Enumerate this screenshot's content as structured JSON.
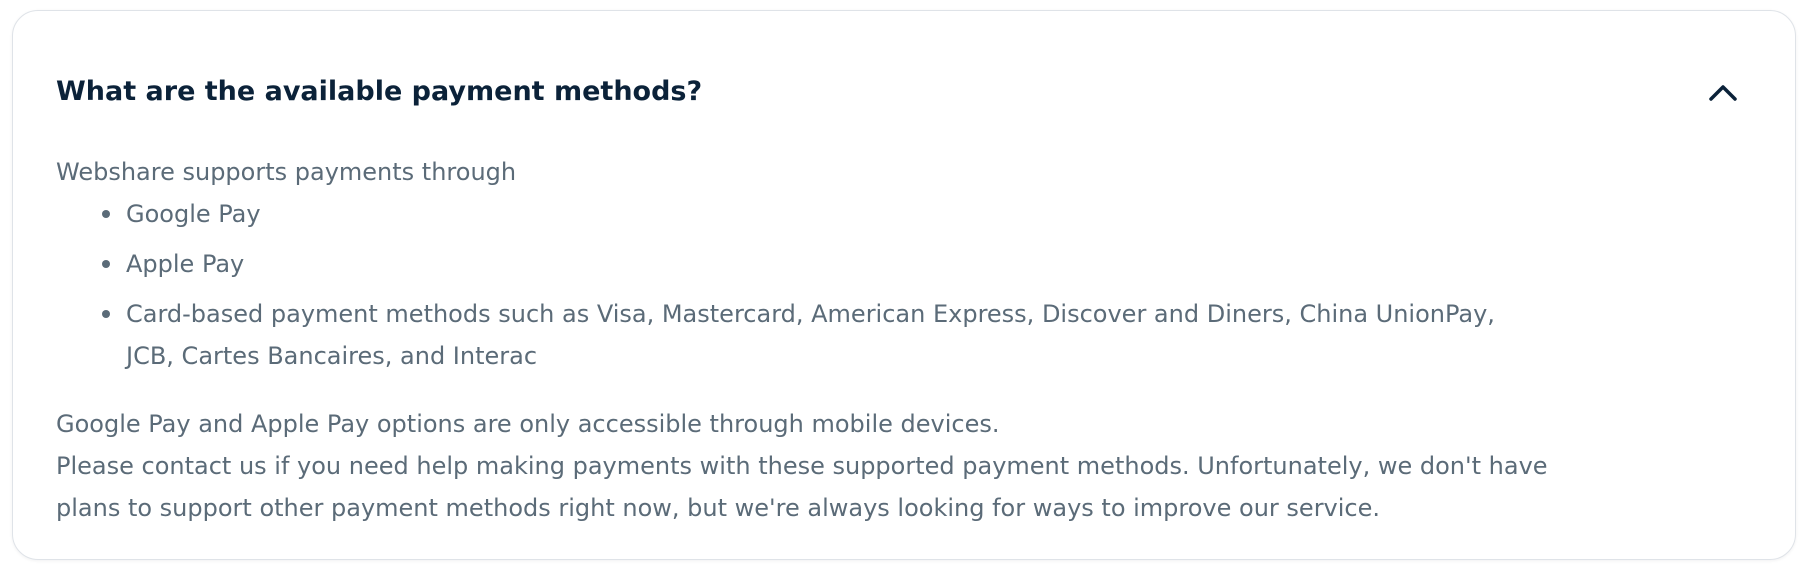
{
  "faq": {
    "question": "What are the available payment methods?",
    "toggle_icon": "chevron-up-icon",
    "answer": {
      "intro": "Webshare supports payments through",
      "methods": [
        {
          "label": "Google Pay"
        },
        {
          "label": "Apple Pay"
        },
        {
          "label": "Card-based payment methods such as Visa, Mastercard, American Express, Discover and Diners, China UnionPay, JCB, Cartes Bancaires, and Interac"
        }
      ],
      "note": "Google Pay and Apple Pay options are only accessible through mobile devices.",
      "contact": "Please contact us if you need help making payments with these supported payment methods. Unfortunately, we don't have plans to support other payment methods right now, but we're always looking for ways to improve our service."
    }
  },
  "colors": {
    "question_text": "#0b2239",
    "body_text": "#5b6b78",
    "card_border": "#dfe3e8",
    "background": "#ffffff"
  }
}
